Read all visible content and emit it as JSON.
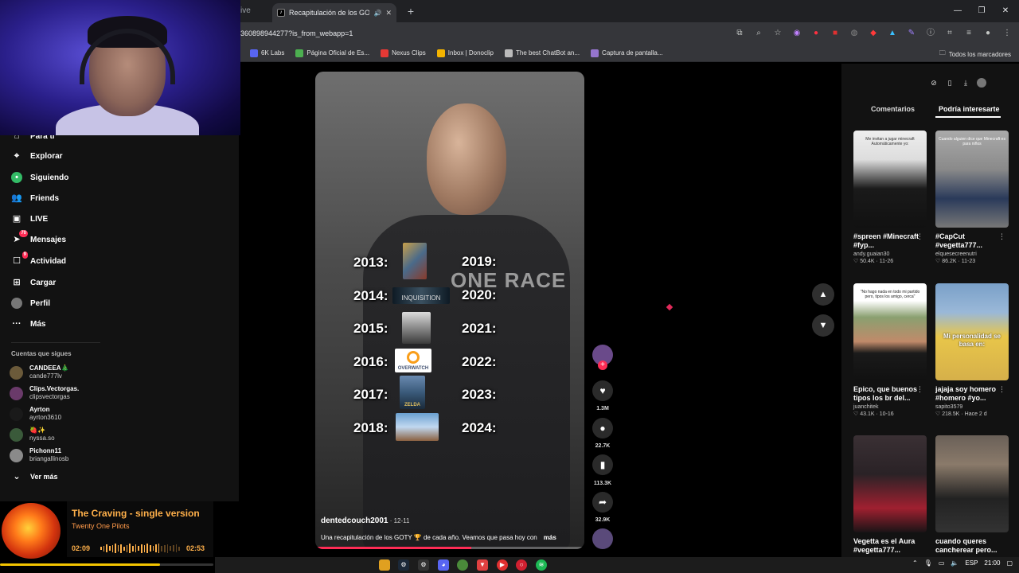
{
  "browser": {
    "tab_fragment": "ive",
    "active_tab_title": "Recapitulación de los GOTY",
    "new_tab": "+",
    "url": "360898944277?is_from_webapp=1",
    "bookmarks": [
      {
        "label": "6K Labs",
        "icon": "6k-icon",
        "color": "#5865f2"
      },
      {
        "label": "Página Oficial de Es...",
        "icon": "globe-icon",
        "color": "#4caf50"
      },
      {
        "label": "Nexus Clips",
        "icon": "clips-icon",
        "color": "#e53935"
      },
      {
        "label": "Inbox | Donoclip",
        "icon": "inbox-icon",
        "color": "#f4b400"
      },
      {
        "label": "The best ChatBot an...",
        "icon": "bot-icon",
        "color": "#bbbbbb"
      },
      {
        "label": "Captura de pantalla...",
        "icon": "capture-icon",
        "color": "#9575cd"
      }
    ],
    "all_bookmarks": "Todos los marcadores"
  },
  "sidebar": {
    "items": [
      {
        "label": "Para ti",
        "icon": "home-icon"
      },
      {
        "label": "Explorar",
        "icon": "compass-icon"
      },
      {
        "label": "Siguiendo",
        "icon": "following-icon"
      },
      {
        "label": "Friends",
        "icon": "friends-icon"
      },
      {
        "label": "LIVE",
        "icon": "live-icon"
      },
      {
        "label": "Mensajes",
        "icon": "messages-icon",
        "badge": "70"
      },
      {
        "label": "Actividad",
        "icon": "activity-icon",
        "badge": "9"
      },
      {
        "label": "Cargar",
        "icon": "upload-icon"
      },
      {
        "label": "Perfil",
        "icon": "profile-icon"
      },
      {
        "label": "Más",
        "icon": "more-icon"
      }
    ],
    "following_title": "Cuentas que sigues",
    "accounts": [
      {
        "name": "CANDEEA🎄",
        "handle": "cande777lv"
      },
      {
        "name": "Clips.Vectorgas.",
        "handle": "clipsvectorgas"
      },
      {
        "name": "Ayrton",
        "handle": "ayrton3610"
      },
      {
        "name": "🍓✨",
        "handle": "nyssa.so"
      },
      {
        "name": "Pichonn11",
        "handle": "briangallinosb"
      }
    ],
    "see_more": "Ver más"
  },
  "player": {
    "song": "The Craving - single version",
    "artist": "Twenty One Pilots",
    "elapsed": "02:09",
    "total": "02:53",
    "progress": 0.74,
    "volume": 0.75
  },
  "video": {
    "shirt_text": "ONE RACE",
    "years_left": [
      "2013:",
      "2014:",
      "2015:",
      "2016:",
      "2017:",
      "2018:"
    ],
    "years_right": [
      "2019:",
      "2020:",
      "2021:",
      "2022:",
      "2023:",
      "2024:"
    ],
    "game_labels": {
      "inquisition": "INQUISITION",
      "overwatch": "OVERWATCH",
      "zelda": "ZELDA"
    },
    "author": "dentedcouch2001",
    "date": " · 12-11",
    "caption": "Una recapitulación de los GOTY 🏆 de cada año. Veamos que pasa hoy con",
    "more": "más",
    "progress": 0.58
  },
  "actions": {
    "likes": "1.3M",
    "comments": "22.7K",
    "saves": "113.3K",
    "shares": "32.9K"
  },
  "right_panel": {
    "tabs": [
      "Comentarios",
      "Podría interesarte"
    ],
    "cards": [
      {
        "thumb_label": "Me invitan a jugar minecraft Automáticamente yo:",
        "desc": "#spreen #Minecraft #fyp...",
        "user": "andy.guaian30",
        "likes": "♡ 50.4K",
        "date": "11-26",
        "bg": "#3a3a3a"
      },
      {
        "thumb_label": "Cuando alguien dice que Minecraft es para niños",
        "desc": "#CapCut #vegetta777...",
        "user": "elquesecreenutri",
        "likes": "♡ 86.2K",
        "date": "11-23",
        "bg": "#8c8c8c"
      },
      {
        "thumb_label": "\"No hago nada en todo mi partido pero, tipos los amigo, cerca\"",
        "desc": "Epico, que buenos tipos los br del...",
        "user": "juanchitek",
        "likes": "♡ 43.1K",
        "date": "10-16",
        "bg": "#6a8a5a"
      },
      {
        "thumb_label": "Mi personalidad se basa en:",
        "desc": "jajaja soy homero #homero #yo...",
        "user": "sapito3579",
        "likes": "♡ 218.5K",
        "date": "Hace 2 d",
        "bg": "#7aa0c8"
      },
      {
        "thumb_label": "",
        "desc": "Vegetta es el Aura #vegetta777...",
        "user": "",
        "likes": "",
        "date": "",
        "bg": "#2a2226"
      },
      {
        "thumb_label": "",
        "desc": "cuando queres cancherear pero...",
        "user": "",
        "likes": "",
        "date": "",
        "bg": "#5a5048"
      }
    ]
  },
  "taskbar": {
    "lang": "ESP",
    "time": "21:00"
  }
}
